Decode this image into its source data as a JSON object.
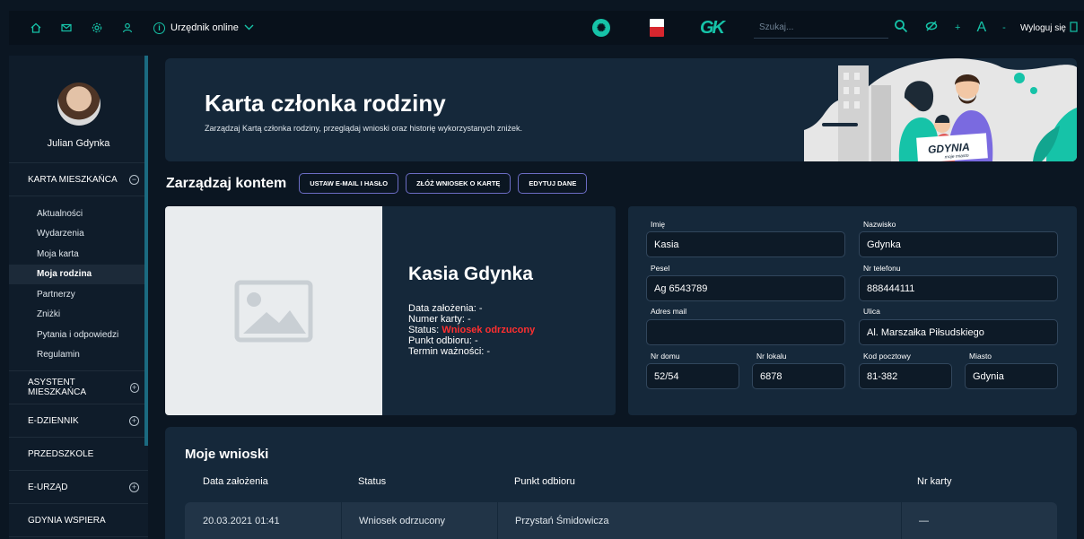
{
  "topbar": {
    "icons": [
      "home-icon",
      "mail-icon",
      "gear-icon",
      "user-icon"
    ],
    "urzednik_label": "Urzędnik online",
    "search_placeholder": "Szukaj...",
    "font_plus": "+",
    "font_label": "A",
    "font_minus": "-",
    "logout_label": "Wyloguj się"
  },
  "sidebar": {
    "user_name": "Julian Gdynka",
    "section_karta": "KARTA MIESZKAŃCA",
    "karta_items": [
      {
        "label": "Aktualności",
        "active": false
      },
      {
        "label": "Wydarzenia",
        "active": false
      },
      {
        "label": "Moja karta",
        "active": false
      },
      {
        "label": "Moja rodzina",
        "active": true
      },
      {
        "label": "Partnerzy",
        "active": false
      },
      {
        "label": "Zniżki",
        "active": false
      },
      {
        "label": "Pytania i odpowiedzi",
        "active": false
      },
      {
        "label": "Regulamin",
        "active": false
      }
    ],
    "section_asystent": "ASYSTENT MIESZKAŃCA",
    "section_edziennik": "E-DZIENNIK",
    "section_przedszkole": "PRZEDSZKOLE",
    "section_eurzad": "E-URZĄD",
    "section_wspiera": "GDYNIA WSPIERA"
  },
  "hero": {
    "title": "Karta członka rodziny",
    "subtitle": "Zarządzaj Kartą członka rodziny, przeglądaj wnioski oraz historię wykorzystanych zniżek.",
    "sign_main": "GDYNIA",
    "sign_sub": "moje miasto"
  },
  "manage": {
    "title": "Zarządzaj kontem",
    "btn_email": "USTAW E-MAIL I HASŁO",
    "btn_wniosek": "ZŁÓŻ WNIOSEK O KARTĘ",
    "btn_edytuj": "EDYTUJ DANE"
  },
  "card": {
    "name": "Kasia Gdynka",
    "date_label": "Data założenia:",
    "date_value": "-",
    "number_label": "Numer karty:",
    "number_value": "-",
    "status_label": "Status:",
    "status_value": "Wniosek odrzucony",
    "pickup_label": "Punkt odbioru:",
    "pickup_value": "-",
    "expiry_label": "Termin ważności:",
    "expiry_value": "-"
  },
  "form": {
    "imie_label": "Imię",
    "imie_value": "Kasia",
    "nazwisko_label": "Nazwisko",
    "nazwisko_value": "Gdynka",
    "pesel_label": "Pesel",
    "pesel_value": "Ag 6543789",
    "telefon_label": "Nr telefonu",
    "telefon_value": "888444111",
    "mail_label": "Adres mail",
    "mail_value": "",
    "ulica_label": "Ulica",
    "ulica_value": "Al. Marszałka Piłsudskiego",
    "dom_label": "Nr domu",
    "dom_value": "52/54",
    "lokal_label": "Nr lokalu",
    "lokal_value": "6878",
    "kod_label": "Kod pocztowy",
    "kod_value": "81-382",
    "miasto_label": "Miasto",
    "miasto_value": "Gdynia"
  },
  "applications": {
    "title": "Moje wnioski",
    "headers": [
      "Data założenia",
      "Status",
      "Punkt odbioru",
      "Nr karty"
    ],
    "rows": [
      [
        "20.03.2021 01:41",
        "Wniosek odrzucony",
        "Przystań Śmidowicza",
        "—"
      ]
    ]
  },
  "colors": {
    "accent": "#16c3a8",
    "background": "#0b1622",
    "panel": "#15283a",
    "status_rejected": "#ff2f2f",
    "button_border": "#6b6cc4"
  }
}
